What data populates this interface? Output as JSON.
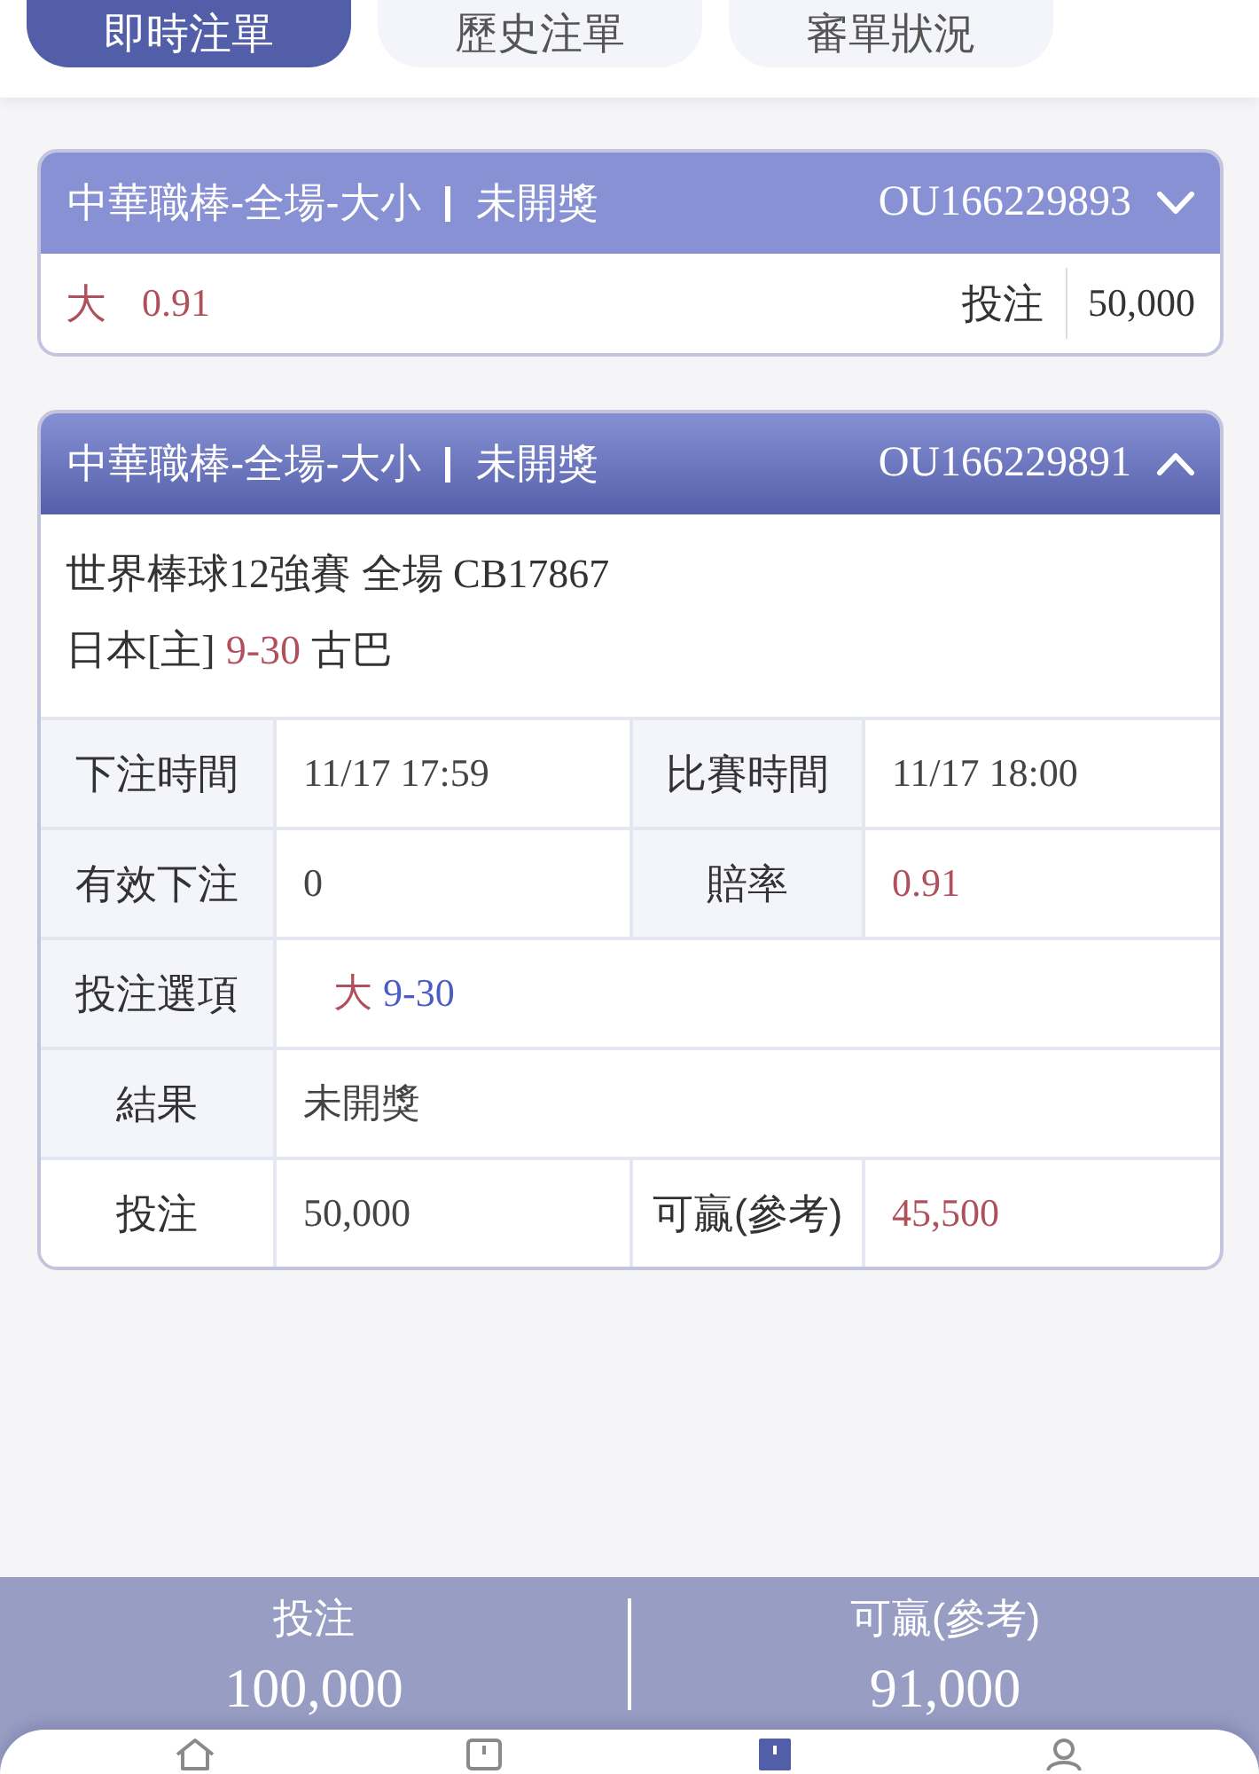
{
  "tabs": [
    {
      "label": "即時注單",
      "selected": true
    },
    {
      "label": "歷史注單",
      "selected": false
    },
    {
      "label": "審單狀況",
      "selected": false
    }
  ],
  "bets": [
    {
      "title": "中華職棒-全場-大小",
      "status": "未開獎",
      "bet_id": "OU166229893",
      "expanded": false,
      "summary": {
        "pick": "大",
        "odds": "0.91",
        "stake_label": "投注",
        "stake": "50,000"
      }
    },
    {
      "title": "中華職棒-全場-大小",
      "status": "未開獎",
      "bet_id": "OU166229891",
      "expanded": true,
      "event": "世界棒球12強賽 全場 CB17867",
      "home": "日本[主]",
      "score": "9-30",
      "away": "古巴",
      "details": [
        {
          "kind": "pair",
          "cells": [
            {
              "label": "下注時間",
              "value": "11/17 17:59"
            },
            {
              "label": "比賽時間",
              "value": "11/17 18:00"
            }
          ]
        },
        {
          "kind": "pair",
          "cells": [
            {
              "label": "有效下注",
              "value": "0"
            },
            {
              "label": "賠率",
              "value": "0.91",
              "color": "#b0505d"
            }
          ]
        },
        {
          "kind": "selection",
          "label": "投注選項",
          "pick": "大",
          "line": "9-30"
        },
        {
          "kind": "single",
          "label": "結果",
          "value": "未開獎"
        },
        {
          "kind": "total",
          "cells": [
            {
              "label": "投注",
              "value": "50,000"
            },
            {
              "label": "可贏(參考)",
              "value": "45,500",
              "color": "#b0505d"
            }
          ]
        }
      ]
    }
  ],
  "totals": [
    {
      "label": "投注",
      "value": "100,000"
    },
    {
      "label": "可贏(參考)",
      "value": "91,000"
    }
  ],
  "nav": [
    {
      "kind": "home",
      "selected": false
    },
    {
      "kind": "box",
      "selected": false
    },
    {
      "kind": "bets",
      "selected": true
    },
    {
      "kind": "user",
      "selected": false
    }
  ]
}
